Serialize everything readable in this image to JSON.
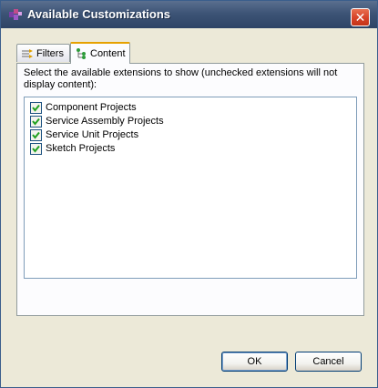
{
  "window": {
    "title": "Available Customizations",
    "close_label": "✕"
  },
  "tabs": [
    {
      "label": "Filters",
      "icon": "filters-icon",
      "active": false
    },
    {
      "label": "Content",
      "icon": "content-icon",
      "active": true
    }
  ],
  "content": {
    "description": "Select the available extensions to show (unchecked extensions will not display content):",
    "items": [
      {
        "label": "Component Projects",
        "checked": true
      },
      {
        "label": "Service Assembly Projects",
        "checked": true
      },
      {
        "label": "Service Unit Projects",
        "checked": true
      },
      {
        "label": "Sketch Projects",
        "checked": true
      }
    ]
  },
  "buttons": {
    "ok_label": "OK",
    "cancel_label": "Cancel"
  },
  "colors": {
    "titlebar": "#3d5476",
    "close_button": "#d8452a",
    "dialog_background": "#ece9d8",
    "checkmark": "#21a121",
    "active_tab_accent": "#e6a100"
  }
}
